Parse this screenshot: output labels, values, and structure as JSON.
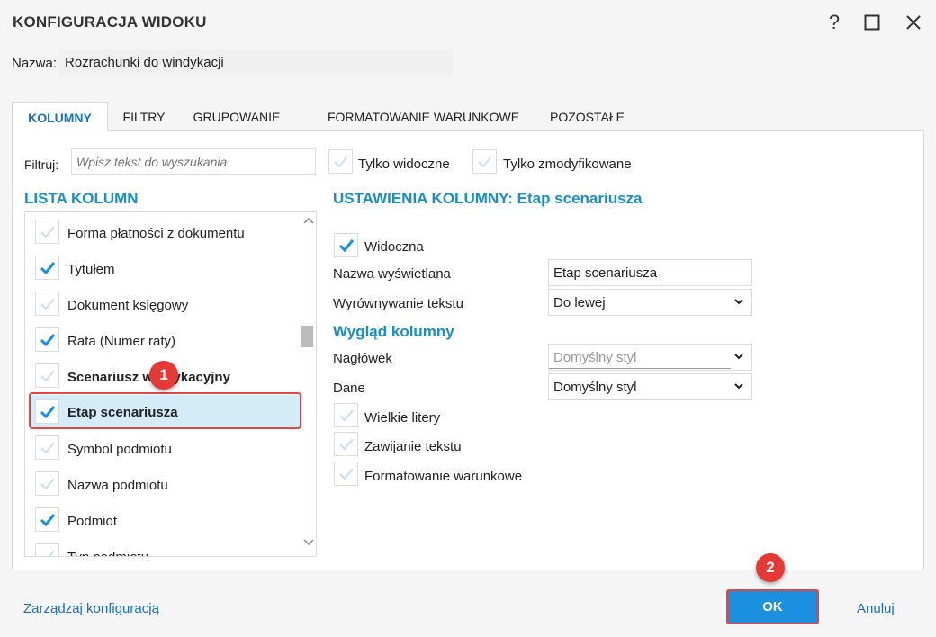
{
  "window": {
    "title": "KONFIGURACJA WIDOKU",
    "help_glyph": "?",
    "icons": [
      "help-icon",
      "maximize-icon",
      "close-icon"
    ]
  },
  "name": {
    "label": "Nazwa:",
    "value": "Rozrachunki do windykacji"
  },
  "tabs": [
    {
      "label": "KOLUMNY",
      "active": true
    },
    {
      "label": "FILTRY",
      "active": false
    },
    {
      "label": "GRUPOWANIE",
      "active": false
    },
    {
      "label": "FORMATOWANIE WARUNKOWE",
      "active": false
    },
    {
      "label": "POZOSTAŁE",
      "active": false
    }
  ],
  "filter": {
    "label": "Filtruj:",
    "placeholder": "Wpisz tekst do wyszukania",
    "only_visible": "Tylko widoczne",
    "only_modified": "Tylko zmodyfikowane"
  },
  "columns_list": {
    "title": "LISTA KOLUMN",
    "items": [
      {
        "label": "Forma płatności z dokumentu",
        "checked": false
      },
      {
        "label": "Tytułem",
        "checked": true
      },
      {
        "label": "Dokument księgowy",
        "checked": false
      },
      {
        "label": "Rata (Numer raty)",
        "checked": true
      },
      {
        "label": "Scenariusz windykacyjny",
        "checked": false,
        "bold": true
      },
      {
        "label": "Etap scenariusza",
        "checked": true,
        "bold": true,
        "selected": true
      },
      {
        "label": "Symbol podmiotu",
        "checked": false
      },
      {
        "label": "Nazwa podmiotu",
        "checked": false
      },
      {
        "label": "Podmiot",
        "checked": true
      },
      {
        "label": "Typ podmiotu",
        "checked": false
      }
    ]
  },
  "settings": {
    "title": "USTAWIENIA KOLUMNY: Etap scenariusza",
    "visible_label": "Widoczna",
    "display_name_label": "Nazwa wyświetlana",
    "display_name_value": "Etap scenariusza",
    "alignment_label": "Wyrównywanie tekstu",
    "alignment_value": "Do lewej",
    "appearance_title": "Wygląd kolumny",
    "header_label": "Nagłówek",
    "header_value": "Domyślny styl",
    "data_label": "Dane",
    "data_value": "Domyślny styl",
    "uppercase_label": "Wielkie litery",
    "wrap_label": "Zawijanie tekstu",
    "conditional_label": "Formatowanie warunkowe"
  },
  "annotations": {
    "badge1": "1",
    "badge2": "2"
  },
  "footer": {
    "manage": "Zarządzaj konfiguracją",
    "ok": "OK",
    "cancel": "Anuluj"
  },
  "colors": {
    "accent": "#1a90de",
    "section_title": "#1a8fc0",
    "highlight": "#e04646",
    "selected_row": "#d4ecf8",
    "badge": "#e53935"
  }
}
